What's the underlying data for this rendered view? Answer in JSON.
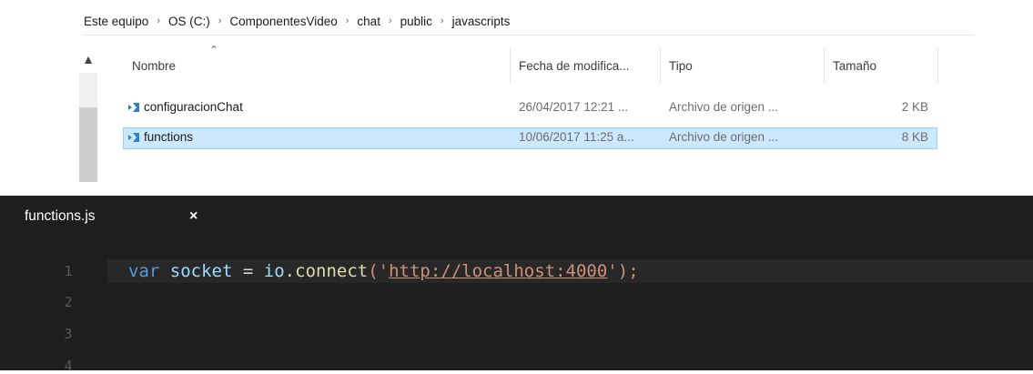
{
  "explorer": {
    "breadcrumb": [
      "Este equipo",
      "OS (C:)",
      "ComponentesVideo",
      "chat",
      "public",
      "javascripts"
    ],
    "columns": {
      "name": "Nombre",
      "date": "Fecha de modifica...",
      "type": "Tipo",
      "size": "Tamaño"
    },
    "files": [
      {
        "name": "configuracionChat",
        "date": "26/04/2017 12:21 ...",
        "type": "Archivo de origen ...",
        "size": "2 KB",
        "selected": false
      },
      {
        "name": "functions",
        "date": "10/06/2017 11:25 a...",
        "type": "Archivo de origen ...",
        "size": "8 KB",
        "selected": true
      }
    ],
    "colors": {
      "selection_bg": "#cce8ff",
      "selection_border": "#99d1ff",
      "file_icon": "#2f80d1"
    },
    "icons": {
      "sort": "chevron-up-icon",
      "scroll_up": "triangle-up-icon",
      "file": "vscode-file-icon",
      "separator": "chevron-right-icon"
    }
  },
  "editor": {
    "tab_title": "functions.js",
    "tab_close": "×",
    "line_numbers": [
      "1",
      "2",
      "3",
      "4"
    ],
    "code": {
      "keyword": "var",
      "variable": "socket",
      "equals": "=",
      "object": "io",
      "method": "connect",
      "open": "('",
      "url": "http://localhost:4000",
      "close": "');"
    },
    "colors": {
      "background": "#1e1e1e",
      "keyword": "#569cd6",
      "string": "#ce9178",
      "current_line": "#282828"
    }
  }
}
